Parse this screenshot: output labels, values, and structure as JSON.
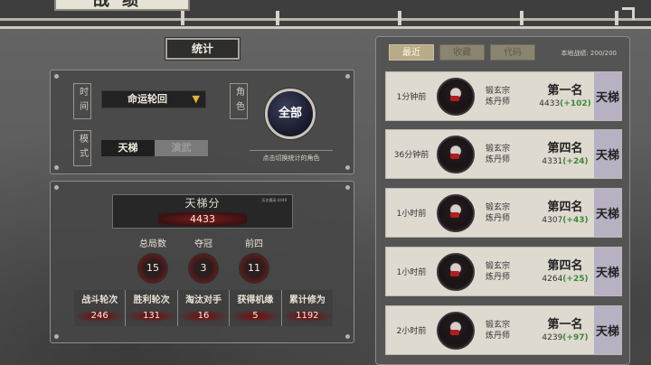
{
  "page": {
    "title": "战绩"
  },
  "stats_tab": {
    "label": "统计"
  },
  "filters": {
    "time_label": "时间",
    "time_value": "命运轮回",
    "role_label": "角色",
    "mode_label": "模式",
    "mode_options": [
      "天梯",
      "演武"
    ],
    "mode_selected": "天梯",
    "all_button": "全部",
    "all_hint": "点击切换统计的角色"
  },
  "score": {
    "title": "天梯分",
    "subtitle": "历史最高:4449",
    "value": "4433"
  },
  "summary": [
    {
      "label": "总局数",
      "value": "15"
    },
    {
      "label": "夺冠",
      "value": "3"
    },
    {
      "label": "前四",
      "value": "11"
    }
  ],
  "details": [
    {
      "label": "战斗轮次",
      "value": "246"
    },
    {
      "label": "胜利轮次",
      "value": "131"
    },
    {
      "label": "淘汰对手",
      "value": "16"
    },
    {
      "label": "获得机缘",
      "value": "5"
    },
    {
      "label": "累计修为",
      "value": "1192"
    }
  ],
  "history": {
    "tabs": [
      "最近",
      "收藏",
      "代码"
    ],
    "local_count": "本地战绩: 200/200",
    "records": [
      {
        "time": "1分钟前",
        "clan_line1": "锻玄宗",
        "clan_line2": "炼丹师",
        "rank": "第一名",
        "score": "4433",
        "delta": "(+102)",
        "mode": "天梯"
      },
      {
        "time": "36分钟前",
        "clan_line1": "锻玄宗",
        "clan_line2": "炼丹师",
        "rank": "第四名",
        "score": "4331",
        "delta": "(+24)",
        "mode": "天梯"
      },
      {
        "time": "1小时前",
        "clan_line1": "锻玄宗",
        "clan_line2": "炼丹师",
        "rank": "第四名",
        "score": "4307",
        "delta": "(+43)",
        "mode": "天梯"
      },
      {
        "time": "1小时前",
        "clan_line1": "锻玄宗",
        "clan_line2": "炼丹师",
        "rank": "第四名",
        "score": "4264",
        "delta": "(+25)",
        "mode": "天梯"
      },
      {
        "time": "2小时前",
        "clan_line1": "锻玄宗",
        "clan_line2": "炼丹师",
        "rank": "第一名",
        "score": "4239",
        "delta": "(+97)",
        "mode": "天梯"
      }
    ]
  },
  "colors": {
    "delta_positive": "#3c8a35",
    "active_tab": "#b7ab88",
    "all_button": "#1d1f33",
    "ladder_cell": "#b8b0c3"
  }
}
